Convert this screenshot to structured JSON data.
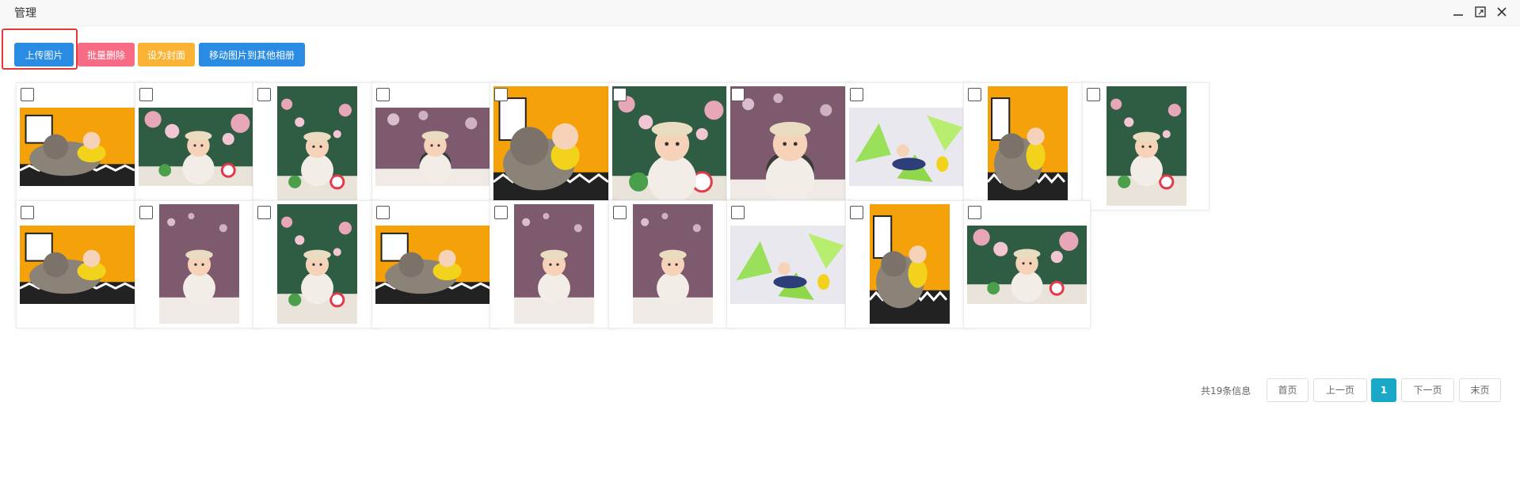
{
  "window": {
    "title": "管理"
  },
  "toolbar": {
    "upload_label": "上传图片",
    "batch_delete_label": "批量删除",
    "set_cover_label": "设为封面",
    "move_label": "移动图片到其他相册"
  },
  "colors": {
    "upload": "#2a8be3",
    "batch_delete": "#f76b85",
    "set_cover": "#fbb335",
    "move": "#2a8be3",
    "highlight": "#e53935",
    "page_active": "#1aa8c9"
  },
  "photos": [
    {
      "shape": "landscape",
      "scene": "baby-elephant-orange"
    },
    {
      "shape": "landscape",
      "scene": "baby-flowers-green"
    },
    {
      "shape": "portrait",
      "scene": "baby-flowers-green"
    },
    {
      "shape": "landscape",
      "scene": "baby-purple-bokeh"
    },
    {
      "shape": "square",
      "scene": "baby-elephant-orange"
    },
    {
      "shape": "square",
      "scene": "baby-flowers-green"
    },
    {
      "shape": "square",
      "scene": "baby-purple-bokeh"
    },
    {
      "shape": "landscape",
      "scene": "baby-geometric-green"
    },
    {
      "shape": "portrait",
      "scene": "baby-elephant-orange"
    },
    {
      "shape": "portrait",
      "scene": "baby-flowers-green"
    },
    {
      "shape": "landscape",
      "scene": "baby-elephant-orange"
    },
    {
      "shape": "portrait",
      "scene": "baby-purple-bokeh"
    },
    {
      "shape": "portrait",
      "scene": "baby-flowers-green"
    },
    {
      "shape": "landscape",
      "scene": "baby-elephant-orange"
    },
    {
      "shape": "portrait",
      "scene": "baby-purple-bokeh"
    },
    {
      "shape": "portrait",
      "scene": "baby-purple-bokeh"
    },
    {
      "shape": "landscape",
      "scene": "baby-geometric-green"
    },
    {
      "shape": "portrait",
      "scene": "baby-elephant-orange"
    },
    {
      "shape": "landscape",
      "scene": "baby-flowers-green"
    }
  ],
  "pagination": {
    "total_text": "共19条信息",
    "first": "首页",
    "prev": "上一页",
    "current": "1",
    "next": "下一页",
    "last": "末页"
  }
}
